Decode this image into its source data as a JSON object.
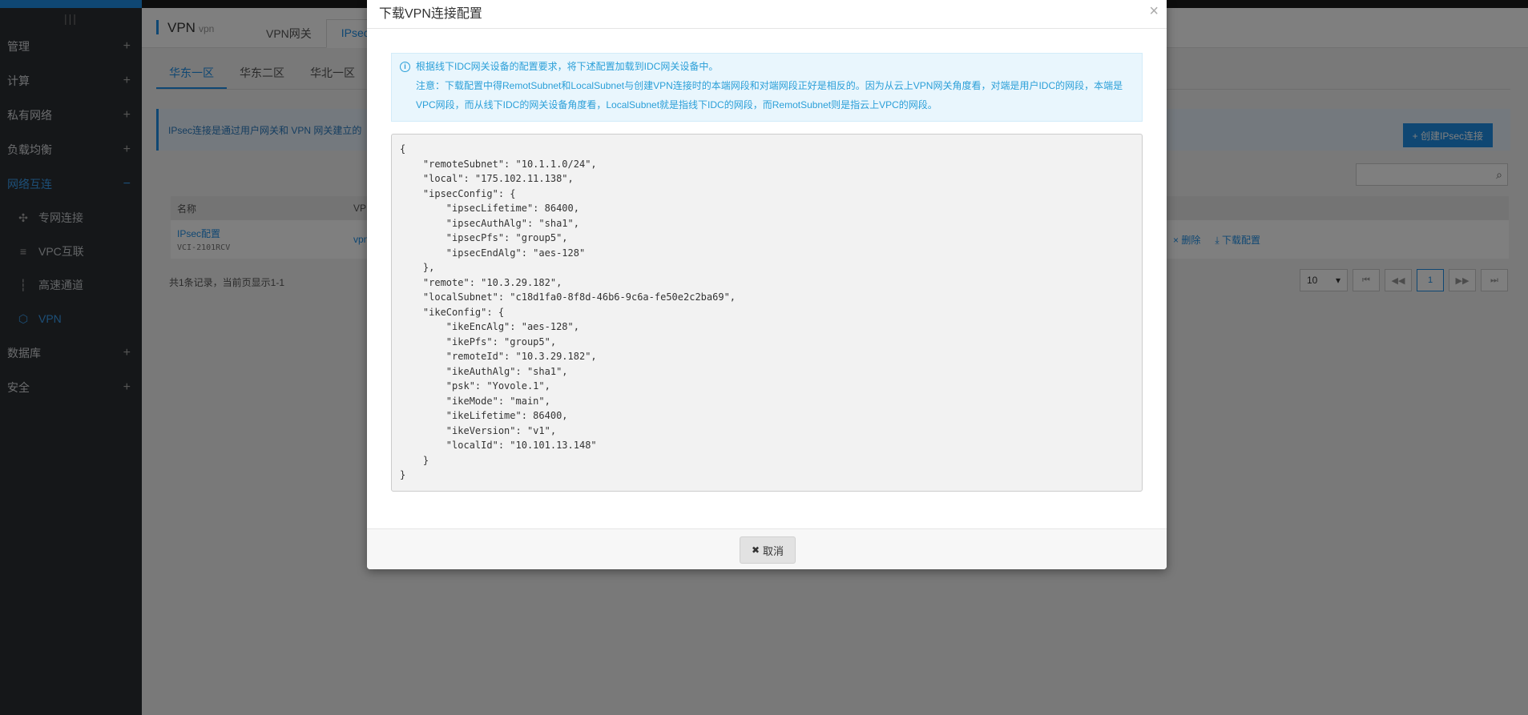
{
  "sidebar": {
    "collapse_label": "|||",
    "groups": [
      {
        "label": "管理"
      },
      {
        "label": "计算"
      },
      {
        "label": "私有网络"
      },
      {
        "label": "负载均衡"
      },
      {
        "label": "网络互连"
      },
      {
        "label": "数据库"
      },
      {
        "label": "安全"
      }
    ],
    "subitems": [
      {
        "label": "专网连接",
        "icon": "network-icon"
      },
      {
        "label": "VPC互联",
        "icon": "vpc-icon"
      },
      {
        "label": "高速通道",
        "icon": "channel-icon"
      },
      {
        "label": "VPN",
        "icon": "vpn-icon"
      }
    ],
    "plus": "+",
    "minus": "−"
  },
  "header": {
    "title": "VPN",
    "title_sub": "vpn",
    "tabs": [
      {
        "label": "VPN网关"
      },
      {
        "label": "IPsec"
      }
    ]
  },
  "zones": [
    {
      "label": "华东一区"
    },
    {
      "label": "华东二区"
    },
    {
      "label": "华北一区"
    }
  ],
  "info_text": "IPsec连接是通过用户网关和 VPN 网关建立的",
  "create_button": "+ 创建IPsec连接",
  "table": {
    "headers": [
      "名称",
      "VP"
    ],
    "row": {
      "name": "IPsec配置",
      "id": "VCI-2101RCV",
      "vpn": "vpn",
      "delete": "× 删除",
      "download": "⤓ 下载配置"
    }
  },
  "footer_info": "共1条记录，当前页显示1-1",
  "pager": {
    "page_size": "10",
    "current": "1"
  },
  "modal": {
    "title": "下载VPN连接配置",
    "close": "×",
    "notice_line1": "根据线下IDC网关设备的配置要求，将下述配置加载到IDC网关设备中。",
    "notice_line2": "注意：下载配置中得RemotSubnet和LocalSubnet与创建VPN连接时的本端网段和对端网段正好是相反的。因为从云上VPN网关角度看，对端是用户IDC的网段，本端是",
    "notice_line3": "VPC网段，而从线下IDC的网关设备角度看，LocalSubnet就是指线下IDC的网段，而RemotSubnet则是指云上VPC的网段。",
    "config_json": "{\n    \"remoteSubnet\": \"10.1.1.0/24\",\n    \"local\": \"175.102.11.138\",\n    \"ipsecConfig\": {\n        \"ipsecLifetime\": 86400,\n        \"ipsecAuthAlg\": \"sha1\",\n        \"ipsecPfs\": \"group5\",\n        \"ipsecEndAlg\": \"aes-128\"\n    },\n    \"remote\": \"10.3.29.182\",\n    \"localSubnet\": \"c18d1fa0-8f8d-46b6-9c6a-fe50e2c2ba69\",\n    \"ikeConfig\": {\n        \"ikeEncAlg\": \"aes-128\",\n        \"ikePfs\": \"group5\",\n        \"remoteId\": \"10.3.29.182\",\n        \"ikeAuthAlg\": \"sha1\",\n        \"psk\": \"Yovole.1\",\n        \"ikeMode\": \"main\",\n        \"ikeLifetime\": 86400,\n        \"ikeVersion\": \"v1\",\n        \"localId\": \"10.101.13.148\"\n    }\n}",
    "cancel_label": "取消",
    "cancel_icon": "✖"
  },
  "colors": {
    "accent": "#1f8fe6",
    "sidebar_bg": "#2b2f33",
    "notice_text": "#2a9fd8"
  }
}
